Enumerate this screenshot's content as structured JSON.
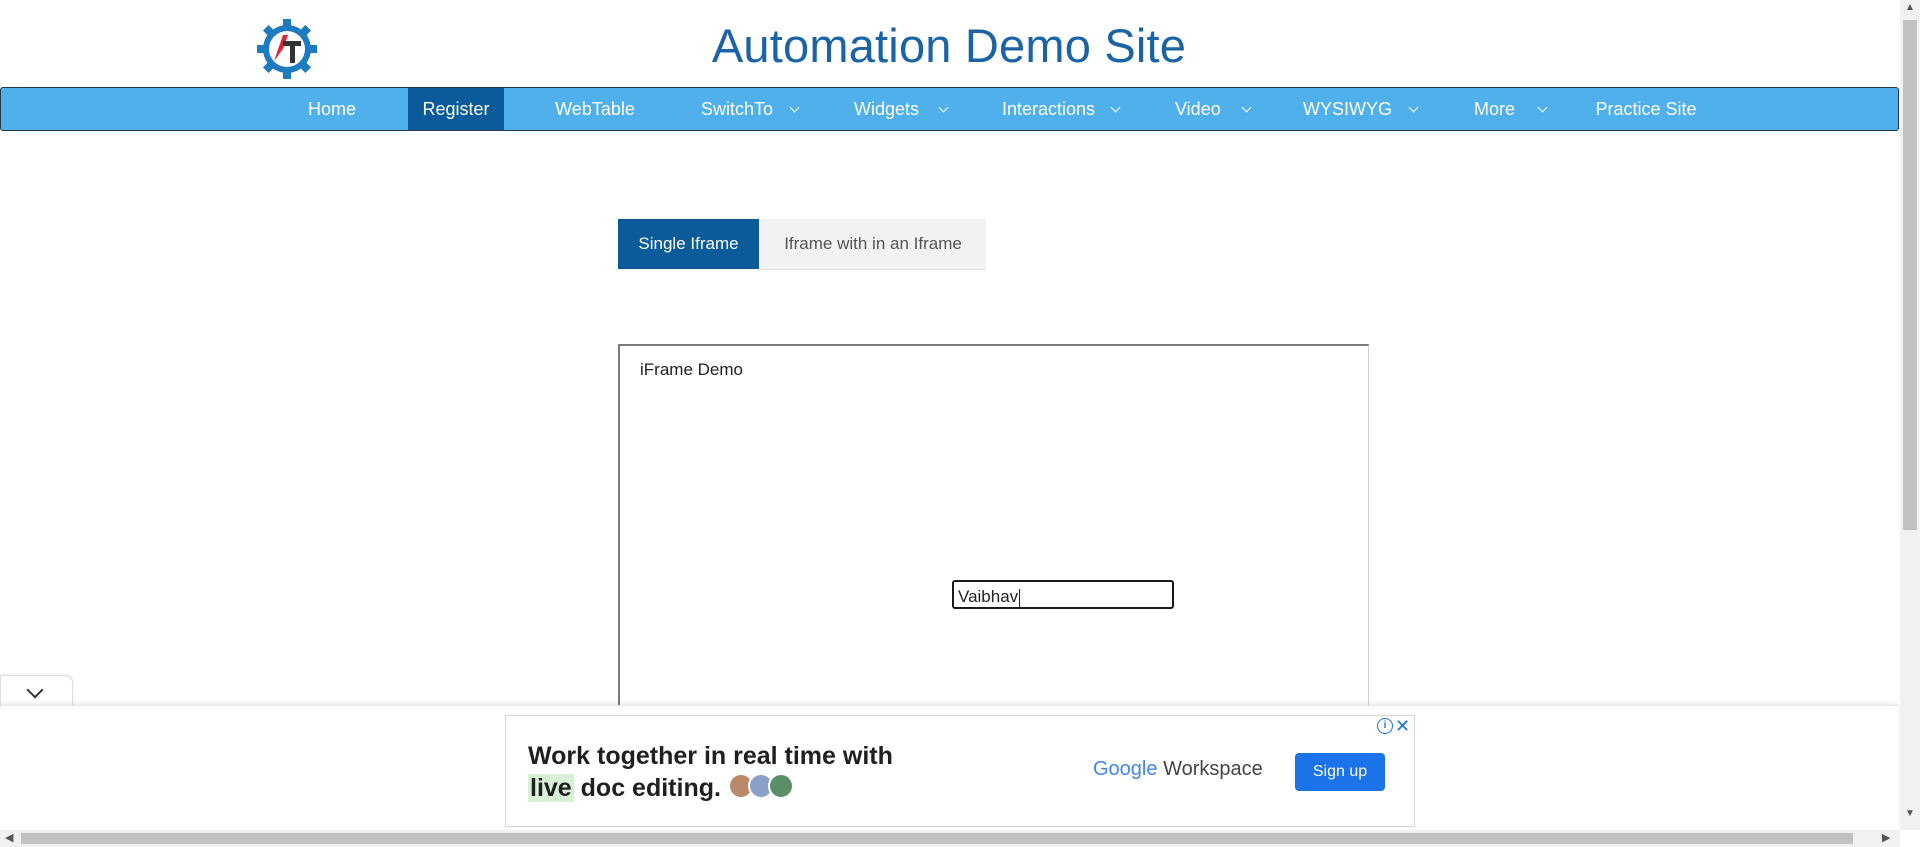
{
  "header": {
    "title": "Automation Demo Site",
    "logo_icon": "gear-logo-icon",
    "logo_text": "AT"
  },
  "nav": {
    "items": [
      {
        "label": "Home",
        "dropdown": false
      },
      {
        "label": "Register",
        "dropdown": false,
        "active": true
      },
      {
        "label": "WebTable",
        "dropdown": false
      },
      {
        "label": "SwitchTo",
        "dropdown": true
      },
      {
        "label": "Widgets",
        "dropdown": true
      },
      {
        "label": "Interactions",
        "dropdown": true
      },
      {
        "label": "Video",
        "dropdown": true
      },
      {
        "label": "WYSIWYG",
        "dropdown": true
      },
      {
        "label": "More",
        "dropdown": true
      },
      {
        "label": "Practice Site",
        "dropdown": false
      }
    ]
  },
  "tabs": {
    "single": "Single Iframe",
    "nested": "Iframe with in an Iframe"
  },
  "iframe": {
    "title": "iFrame Demo",
    "input_value": "Vaibhav"
  },
  "ad": {
    "line1": "Work together in real time with",
    "line2_highlight": "live",
    "line2_rest": "doc editing.",
    "brand_g": "Google",
    "brand_w": "Workspace",
    "cta": "Sign up",
    "info_icon": "ad-info-icon",
    "close_icon": "close-icon"
  },
  "colors": {
    "brand_blue": "#1a63a6",
    "nav_bg": "#4fb0ec",
    "nav_active": "#0b5a99",
    "cta_blue": "#1a73e8"
  }
}
